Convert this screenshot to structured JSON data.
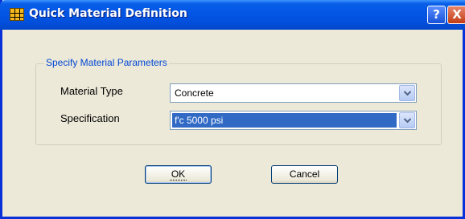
{
  "window": {
    "title": "Quick Material Definition",
    "help_label": "?",
    "close_label": "X"
  },
  "group": {
    "legend": "Specify Material Parameters"
  },
  "fields": {
    "material_type": {
      "label": "Material Type",
      "value": "Concrete"
    },
    "specification": {
      "label": "Specification",
      "value": "f'c 5000 psi"
    }
  },
  "buttons": {
    "ok": "OK",
    "cancel": "Cancel"
  },
  "colors": {
    "title_bar": "#0255e4",
    "dialog_background": "#ece9d8",
    "selection_highlight": "#316ac5",
    "group_legend_text": "#0046d5"
  }
}
